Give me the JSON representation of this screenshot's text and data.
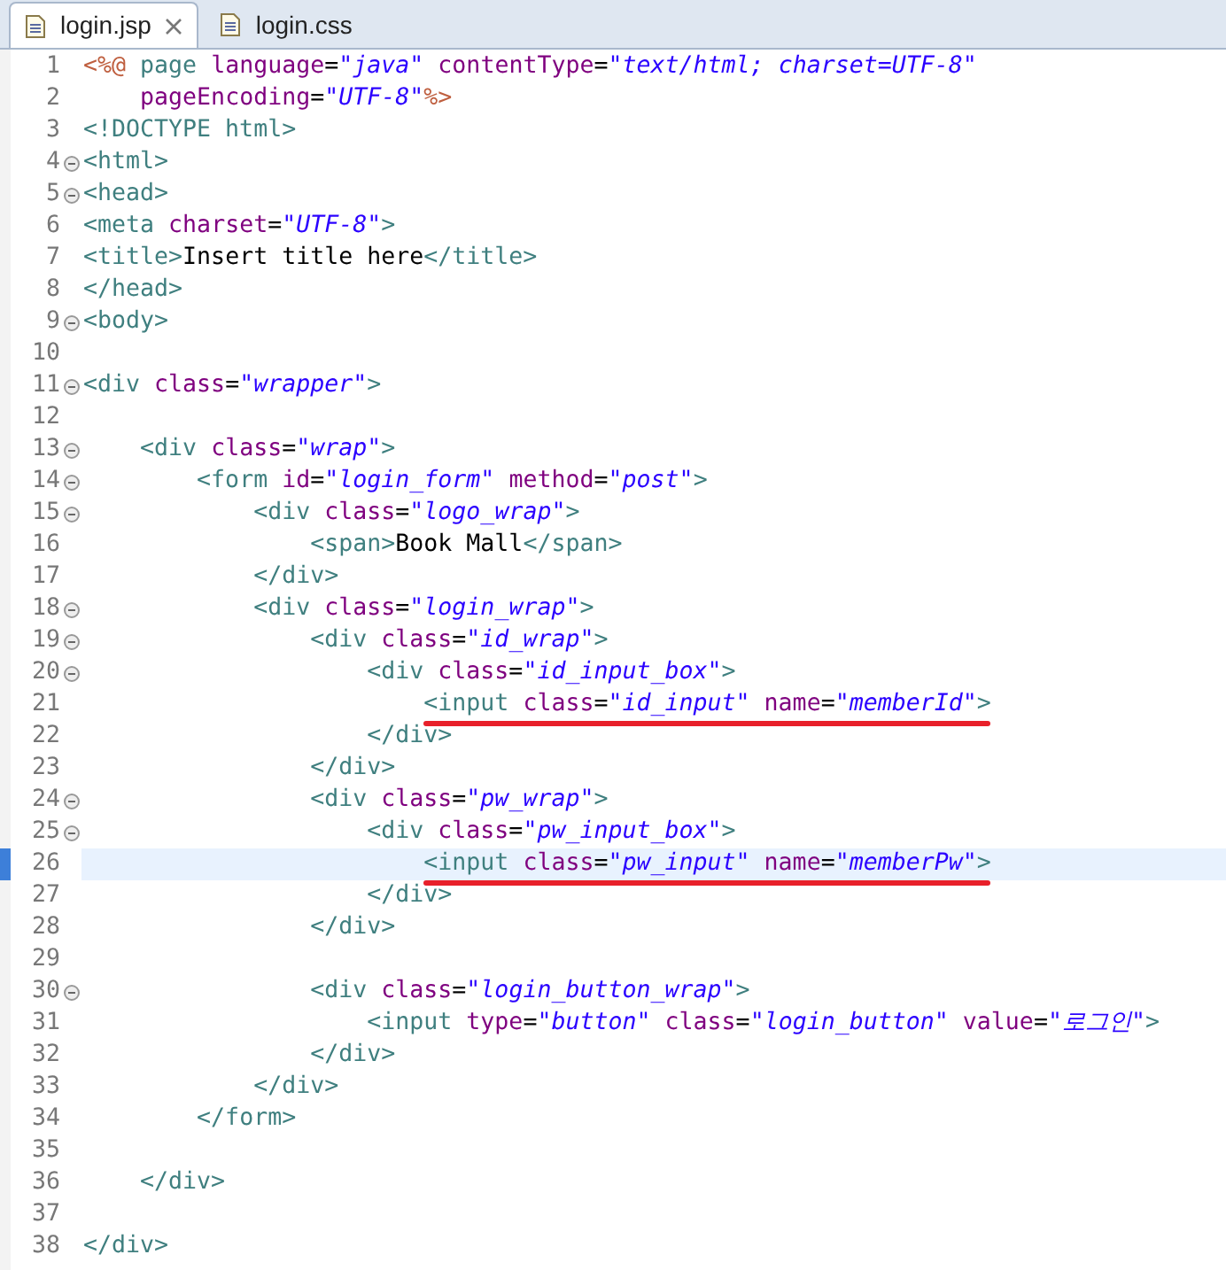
{
  "tabs": [
    {
      "label": "login.jsp",
      "selected": true,
      "closable": true
    },
    {
      "label": "login.css",
      "selected": false,
      "closable": false
    }
  ],
  "editor": {
    "lines": [
      {
        "number": "1",
        "code": [
          {
            "kind": "jsp",
            "text": "<%@ "
          },
          {
            "kind": "tag",
            "text": "page "
          },
          {
            "kind": "attr",
            "text": "language"
          },
          {
            "kind": "text",
            "text": "="
          },
          {
            "kind": "string",
            "text": "\"java\" "
          },
          {
            "kind": "attr",
            "text": "contentType"
          },
          {
            "kind": "text",
            "text": "="
          },
          {
            "kind": "string",
            "text": "\"text/html; charset=UTF-8\""
          }
        ]
      },
      {
        "number": "2",
        "code": [
          {
            "kind": "attr",
            "text": "    pageEncoding"
          },
          {
            "kind": "text",
            "text": "="
          },
          {
            "kind": "string",
            "text": "\"UTF-8\""
          },
          {
            "kind": "jsp",
            "text": "%>"
          }
        ]
      },
      {
        "number": "3",
        "code": [
          {
            "kind": "tag",
            "text": "<!DOCTYPE html>"
          }
        ]
      },
      {
        "number": "4",
        "foldable": true,
        "code": [
          {
            "kind": "tag",
            "text": "<html>"
          }
        ]
      },
      {
        "number": "5",
        "foldable": true,
        "code": [
          {
            "kind": "tag",
            "text": "<head>"
          }
        ]
      },
      {
        "number": "6",
        "code": [
          {
            "kind": "tag",
            "text": "<meta "
          },
          {
            "kind": "attr",
            "text": "charset"
          },
          {
            "kind": "text",
            "text": "="
          },
          {
            "kind": "string",
            "text": "\"UTF-8\""
          },
          {
            "kind": "tag",
            "text": ">"
          }
        ]
      },
      {
        "number": "7",
        "code": [
          {
            "kind": "tag",
            "text": "<title>"
          },
          {
            "kind": "text",
            "text": "Insert title here"
          },
          {
            "kind": "tag",
            "text": "</title>"
          }
        ]
      },
      {
        "number": "8",
        "code": [
          {
            "kind": "tag",
            "text": "</head>"
          }
        ]
      },
      {
        "number": "9",
        "foldable": true,
        "code": [
          {
            "kind": "tag",
            "text": "<body>"
          }
        ]
      },
      {
        "number": "10"
      },
      {
        "number": "11",
        "foldable": true,
        "code": [
          {
            "kind": "tag",
            "text": "<div "
          },
          {
            "kind": "attr",
            "text": "class"
          },
          {
            "kind": "text",
            "text": "="
          },
          {
            "kind": "string",
            "text": "\"wrapper\""
          },
          {
            "kind": "tag",
            "text": ">"
          }
        ]
      },
      {
        "number": "12"
      },
      {
        "number": "13",
        "foldable": true,
        "code": [
          {
            "kind": "tag",
            "text": "    <div "
          },
          {
            "kind": "attr",
            "text": "class"
          },
          {
            "kind": "text",
            "text": "="
          },
          {
            "kind": "string",
            "text": "\"wrap\""
          },
          {
            "kind": "tag",
            "text": ">"
          }
        ]
      },
      {
        "number": "14",
        "foldable": true,
        "code": [
          {
            "kind": "tag",
            "text": "        <form "
          },
          {
            "kind": "attr",
            "text": "id"
          },
          {
            "kind": "text",
            "text": "="
          },
          {
            "kind": "string",
            "text": "\"login_form\" "
          },
          {
            "kind": "attr",
            "text": "method"
          },
          {
            "kind": "text",
            "text": "="
          },
          {
            "kind": "string",
            "text": "\"post\""
          },
          {
            "kind": "tag",
            "text": ">"
          }
        ]
      },
      {
        "number": "15",
        "foldable": true,
        "code": [
          {
            "kind": "tag",
            "text": "            <div "
          },
          {
            "kind": "attr",
            "text": "class"
          },
          {
            "kind": "text",
            "text": "="
          },
          {
            "kind": "string",
            "text": "\"logo_wrap\""
          },
          {
            "kind": "tag",
            "text": ">"
          }
        ]
      },
      {
        "number": "16",
        "code": [
          {
            "kind": "tag",
            "text": "                <span>"
          },
          {
            "kind": "text",
            "text": "Book Mall"
          },
          {
            "kind": "tag",
            "text": "</span>"
          }
        ]
      },
      {
        "number": "17",
        "code": [
          {
            "kind": "tag",
            "text": "            </div>"
          }
        ]
      },
      {
        "number": "18",
        "foldable": true,
        "code": [
          {
            "kind": "tag",
            "text": "            <div "
          },
          {
            "kind": "attr",
            "text": "class"
          },
          {
            "kind": "text",
            "text": "="
          },
          {
            "kind": "string",
            "text": "\"login_wrap\""
          },
          {
            "kind": "tag",
            "text": ">"
          }
        ]
      },
      {
        "number": "19",
        "foldable": true,
        "code": [
          {
            "kind": "tag",
            "text": "                <div "
          },
          {
            "kind": "attr",
            "text": "class"
          },
          {
            "kind": "text",
            "text": "="
          },
          {
            "kind": "string",
            "text": "\"id_wrap\""
          },
          {
            "kind": "tag",
            "text": ">"
          }
        ]
      },
      {
        "number": "20",
        "foldable": true,
        "code": [
          {
            "kind": "tag",
            "text": "                    <div "
          },
          {
            "kind": "attr",
            "text": "class"
          },
          {
            "kind": "text",
            "text": "="
          },
          {
            "kind": "string",
            "text": "\"id_input_box\""
          },
          {
            "kind": "tag",
            "text": ">"
          }
        ]
      },
      {
        "number": "21",
        "underlined": true,
        "code": [
          {
            "kind": "tag",
            "text": "                        <input "
          },
          {
            "kind": "attr",
            "text": "class"
          },
          {
            "kind": "text",
            "text": "="
          },
          {
            "kind": "string",
            "text": "\"id_input\" "
          },
          {
            "kind": "attr",
            "text": "name"
          },
          {
            "kind": "text",
            "text": "="
          },
          {
            "kind": "string",
            "text": "\"memberId\""
          },
          {
            "kind": "tag",
            "text": ">"
          }
        ]
      },
      {
        "number": "22",
        "code": [
          {
            "kind": "tag",
            "text": "                    </div>"
          }
        ]
      },
      {
        "number": "23",
        "code": [
          {
            "kind": "tag",
            "text": "                </div>"
          }
        ]
      },
      {
        "number": "24",
        "foldable": true,
        "code": [
          {
            "kind": "tag",
            "text": "                <div "
          },
          {
            "kind": "attr",
            "text": "class"
          },
          {
            "kind": "text",
            "text": "="
          },
          {
            "kind": "string",
            "text": "\"pw_wrap\""
          },
          {
            "kind": "tag",
            "text": ">"
          }
        ]
      },
      {
        "number": "25",
        "foldable": true,
        "code": [
          {
            "kind": "tag",
            "text": "                    <div "
          },
          {
            "kind": "attr",
            "text": "class"
          },
          {
            "kind": "text",
            "text": "="
          },
          {
            "kind": "string",
            "text": "\"pw_input_box\""
          },
          {
            "kind": "tag",
            "text": ">"
          }
        ]
      },
      {
        "number": "26",
        "underlined": true,
        "current": true,
        "code": [
          {
            "kind": "tag",
            "text": "                        <input "
          },
          {
            "kind": "attr",
            "text": "class"
          },
          {
            "kind": "text",
            "text": "="
          },
          {
            "kind": "string",
            "text": "\"pw_input\" "
          },
          {
            "kind": "attr",
            "text": "name"
          },
          {
            "kind": "text",
            "text": "="
          },
          {
            "kind": "string",
            "text": "\"memberPw\""
          },
          {
            "kind": "tag",
            "text": ">"
          }
        ]
      },
      {
        "number": "27",
        "code": [
          {
            "kind": "tag",
            "text": "                    </div>"
          }
        ]
      },
      {
        "number": "28",
        "code": [
          {
            "kind": "tag",
            "text": "                </div>"
          }
        ]
      },
      {
        "number": "29"
      },
      {
        "number": "30",
        "foldable": true,
        "code": [
          {
            "kind": "tag",
            "text": "                <div "
          },
          {
            "kind": "attr",
            "text": "class"
          },
          {
            "kind": "text",
            "text": "="
          },
          {
            "kind": "string",
            "text": "\"login_button_wrap\""
          },
          {
            "kind": "tag",
            "text": ">"
          }
        ]
      },
      {
        "number": "31",
        "code": [
          {
            "kind": "tag",
            "text": "                    <input "
          },
          {
            "kind": "attr",
            "text": "type"
          },
          {
            "kind": "text",
            "text": "="
          },
          {
            "kind": "string",
            "text": "\"button\" "
          },
          {
            "kind": "attr",
            "text": "class"
          },
          {
            "kind": "text",
            "text": "="
          },
          {
            "kind": "string",
            "text": "\"login_button\" "
          },
          {
            "kind": "attr",
            "text": "value"
          },
          {
            "kind": "text",
            "text": "="
          },
          {
            "kind": "string",
            "text": "\"로그인\""
          },
          {
            "kind": "tag",
            "text": ">"
          }
        ]
      },
      {
        "number": "32",
        "code": [
          {
            "kind": "tag",
            "text": "                </div>"
          }
        ]
      },
      {
        "number": "33",
        "code": [
          {
            "kind": "tag",
            "text": "            </div>"
          }
        ]
      },
      {
        "number": "34",
        "code": [
          {
            "kind": "tag",
            "text": "        </form>"
          }
        ]
      },
      {
        "number": "35"
      },
      {
        "number": "36",
        "code": [
          {
            "kind": "tag",
            "text": "    </div>"
          }
        ]
      },
      {
        "number": "37"
      },
      {
        "number": "38",
        "code": [
          {
            "kind": "tag",
            "text": "</div>"
          }
        ]
      }
    ]
  }
}
